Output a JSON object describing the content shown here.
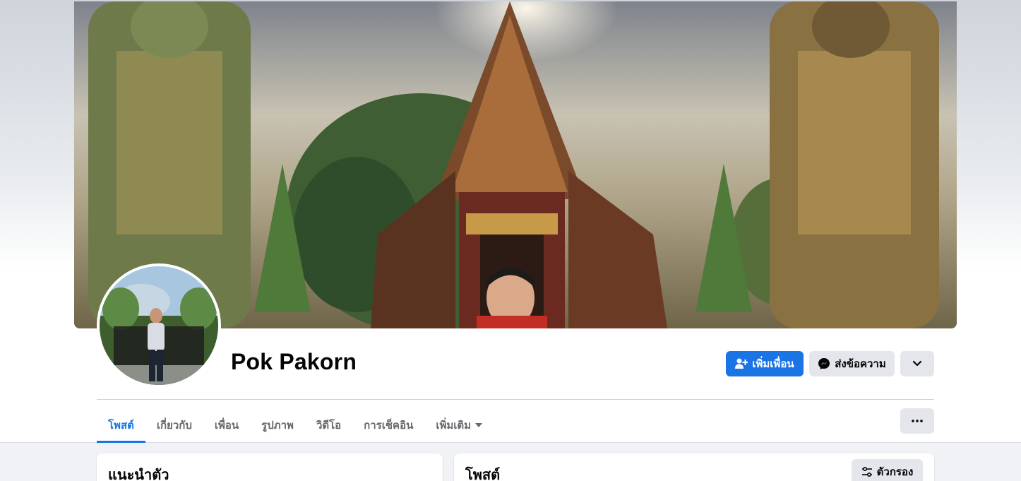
{
  "profile": {
    "name": "Pok Pakorn"
  },
  "actions": {
    "add_friend": "เพิ่มเพื่อน",
    "message": "ส่งข้อความ"
  },
  "tabs": [
    {
      "label": "โพสต์",
      "active": true
    },
    {
      "label": "เกี่ยวกับ",
      "active": false
    },
    {
      "label": "เพื่อน",
      "active": false
    },
    {
      "label": "รูปภาพ",
      "active": false
    },
    {
      "label": "วิดีโอ",
      "active": false
    },
    {
      "label": "การเช็คอิน",
      "active": false
    },
    {
      "label": "เพิ่มเติม",
      "active": false
    }
  ],
  "intro": {
    "title": "แนะนำตัว"
  },
  "posts": {
    "title": "โพสต์",
    "filter_label": "ตัวกรอง"
  },
  "colors": {
    "accent": "#1b74e4",
    "secondary_button": "#e4e6eb",
    "page_background": "#f0f2f5"
  },
  "icons": {
    "add_friend": "person-plus-icon",
    "message": "messenger-icon",
    "chevron": "chevron-down-icon",
    "more": "ellipsis-icon",
    "filter": "sliders-icon",
    "tab_dropdown": "caret-down-icon"
  }
}
